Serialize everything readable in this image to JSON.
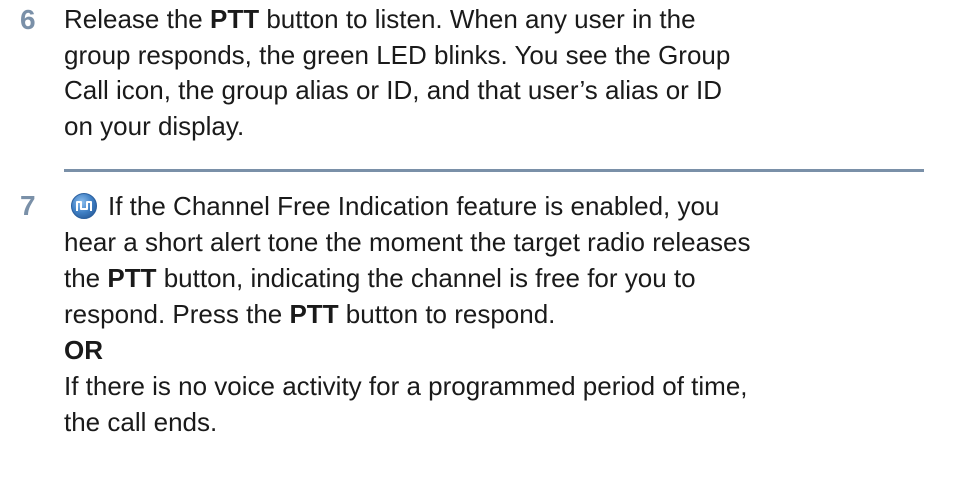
{
  "step6": {
    "number": "6",
    "lines": [
      [
        "Release the ",
        "PTT",
        " button to listen. When any user in the"
      ],
      "group responds, the green LED blinks. You see the Group",
      "Call icon, the group alias or ID, and that user’s alias or ID",
      "on your display."
    ]
  },
  "step7": {
    "number": "7",
    "icon": "channel-free-indication-icon",
    "line1": "If the Channel Free Indication feature is enabled, you",
    "line2": "hear a short alert tone the moment the target radio releases",
    "line3_pre": "the ",
    "line3_bold": "PTT",
    "line3_post": " button, indicating the channel is free for you to",
    "line4_pre": "respond. Press the ",
    "line4_bold": "PTT",
    "line4_post": " button to respond.",
    "or_label": "OR",
    "line6": "If there is no voice activity for a programmed period of time,",
    "line7": "the call ends."
  },
  "colors": {
    "accent": "#7a90a8",
    "icon_blue": "#3f7fc4"
  }
}
